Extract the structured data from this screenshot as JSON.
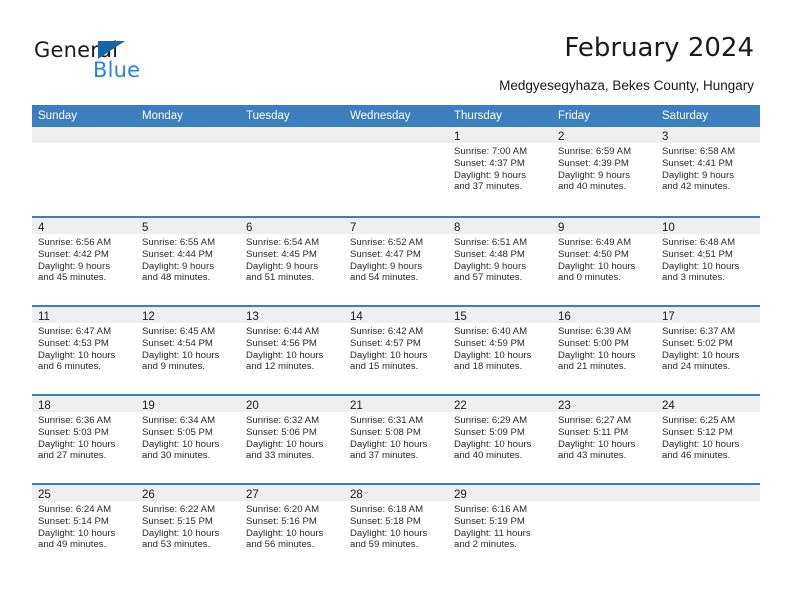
{
  "branding": {
    "logo_text_primary": "General",
    "logo_text_secondary": "Blue",
    "logo_triangle_color": "#1565ad",
    "logo_blue_color": "#2a86d8"
  },
  "header": {
    "title": "February 2024",
    "subtitle": "Medgyesegyhaza, Bekes County, Hungary"
  },
  "theme": {
    "header_band_color": "#3c7ebf",
    "daynum_band_color": "#efefef",
    "row_divider_color": "#3c7ebf",
    "text_color": "#1b1b1b"
  },
  "calendar": {
    "weekdays": [
      "Sunday",
      "Monday",
      "Tuesday",
      "Wednesday",
      "Thursday",
      "Friday",
      "Saturday"
    ],
    "weeks": [
      [
        {
          "day": "",
          "lines": []
        },
        {
          "day": "",
          "lines": []
        },
        {
          "day": "",
          "lines": []
        },
        {
          "day": "",
          "lines": []
        },
        {
          "day": "1",
          "lines": [
            "Sunrise: 7:00 AM",
            "Sunset: 4:37 PM",
            "Daylight: 9 hours",
            "and 37 minutes."
          ]
        },
        {
          "day": "2",
          "lines": [
            "Sunrise: 6:59 AM",
            "Sunset: 4:39 PM",
            "Daylight: 9 hours",
            "and 40 minutes."
          ]
        },
        {
          "day": "3",
          "lines": [
            "Sunrise: 6:58 AM",
            "Sunset: 4:41 PM",
            "Daylight: 9 hours",
            "and 42 minutes."
          ]
        }
      ],
      [
        {
          "day": "4",
          "lines": [
            "Sunrise: 6:56 AM",
            "Sunset: 4:42 PM",
            "Daylight: 9 hours",
            "and 45 minutes."
          ]
        },
        {
          "day": "5",
          "lines": [
            "Sunrise: 6:55 AM",
            "Sunset: 4:44 PM",
            "Daylight: 9 hours",
            "and 48 minutes."
          ]
        },
        {
          "day": "6",
          "lines": [
            "Sunrise: 6:54 AM",
            "Sunset: 4:45 PM",
            "Daylight: 9 hours",
            "and 51 minutes."
          ]
        },
        {
          "day": "7",
          "lines": [
            "Sunrise: 6:52 AM",
            "Sunset: 4:47 PM",
            "Daylight: 9 hours",
            "and 54 minutes."
          ]
        },
        {
          "day": "8",
          "lines": [
            "Sunrise: 6:51 AM",
            "Sunset: 4:48 PM",
            "Daylight: 9 hours",
            "and 57 minutes."
          ]
        },
        {
          "day": "9",
          "lines": [
            "Sunrise: 6:49 AM",
            "Sunset: 4:50 PM",
            "Daylight: 10 hours",
            "and 0 minutes."
          ]
        },
        {
          "day": "10",
          "lines": [
            "Sunrise: 6:48 AM",
            "Sunset: 4:51 PM",
            "Daylight: 10 hours",
            "and 3 minutes."
          ]
        }
      ],
      [
        {
          "day": "11",
          "lines": [
            "Sunrise: 6:47 AM",
            "Sunset: 4:53 PM",
            "Daylight: 10 hours",
            "and 6 minutes."
          ]
        },
        {
          "day": "12",
          "lines": [
            "Sunrise: 6:45 AM",
            "Sunset: 4:54 PM",
            "Daylight: 10 hours",
            "and 9 minutes."
          ]
        },
        {
          "day": "13",
          "lines": [
            "Sunrise: 6:44 AM",
            "Sunset: 4:56 PM",
            "Daylight: 10 hours",
            "and 12 minutes."
          ]
        },
        {
          "day": "14",
          "lines": [
            "Sunrise: 6:42 AM",
            "Sunset: 4:57 PM",
            "Daylight: 10 hours",
            "and 15 minutes."
          ]
        },
        {
          "day": "15",
          "lines": [
            "Sunrise: 6:40 AM",
            "Sunset: 4:59 PM",
            "Daylight: 10 hours",
            "and 18 minutes."
          ]
        },
        {
          "day": "16",
          "lines": [
            "Sunrise: 6:39 AM",
            "Sunset: 5:00 PM",
            "Daylight: 10 hours",
            "and 21 minutes."
          ]
        },
        {
          "day": "17",
          "lines": [
            "Sunrise: 6:37 AM",
            "Sunset: 5:02 PM",
            "Daylight: 10 hours",
            "and 24 minutes."
          ]
        }
      ],
      [
        {
          "day": "18",
          "lines": [
            "Sunrise: 6:36 AM",
            "Sunset: 5:03 PM",
            "Daylight: 10 hours",
            "and 27 minutes."
          ]
        },
        {
          "day": "19",
          "lines": [
            "Sunrise: 6:34 AM",
            "Sunset: 5:05 PM",
            "Daylight: 10 hours",
            "and 30 minutes."
          ]
        },
        {
          "day": "20",
          "lines": [
            "Sunrise: 6:32 AM",
            "Sunset: 5:06 PM",
            "Daylight: 10 hours",
            "and 33 minutes."
          ]
        },
        {
          "day": "21",
          "lines": [
            "Sunrise: 6:31 AM",
            "Sunset: 5:08 PM",
            "Daylight: 10 hours",
            "and 37 minutes."
          ]
        },
        {
          "day": "22",
          "lines": [
            "Sunrise: 6:29 AM",
            "Sunset: 5:09 PM",
            "Daylight: 10 hours",
            "and 40 minutes."
          ]
        },
        {
          "day": "23",
          "lines": [
            "Sunrise: 6:27 AM",
            "Sunset: 5:11 PM",
            "Daylight: 10 hours",
            "and 43 minutes."
          ]
        },
        {
          "day": "24",
          "lines": [
            "Sunrise: 6:25 AM",
            "Sunset: 5:12 PM",
            "Daylight: 10 hours",
            "and 46 minutes."
          ]
        }
      ],
      [
        {
          "day": "25",
          "lines": [
            "Sunrise: 6:24 AM",
            "Sunset: 5:14 PM",
            "Daylight: 10 hours",
            "and 49 minutes."
          ]
        },
        {
          "day": "26",
          "lines": [
            "Sunrise: 6:22 AM",
            "Sunset: 5:15 PM",
            "Daylight: 10 hours",
            "and 53 minutes."
          ]
        },
        {
          "day": "27",
          "lines": [
            "Sunrise: 6:20 AM",
            "Sunset: 5:16 PM",
            "Daylight: 10 hours",
            "and 56 minutes."
          ]
        },
        {
          "day": "28",
          "lines": [
            "Sunrise: 6:18 AM",
            "Sunset: 5:18 PM",
            "Daylight: 10 hours",
            "and 59 minutes."
          ]
        },
        {
          "day": "29",
          "lines": [
            "Sunrise: 6:16 AM",
            "Sunset: 5:19 PM",
            "Daylight: 11 hours",
            "and 2 minutes."
          ]
        },
        {
          "day": "",
          "lines": []
        },
        {
          "day": "",
          "lines": []
        }
      ]
    ]
  }
}
